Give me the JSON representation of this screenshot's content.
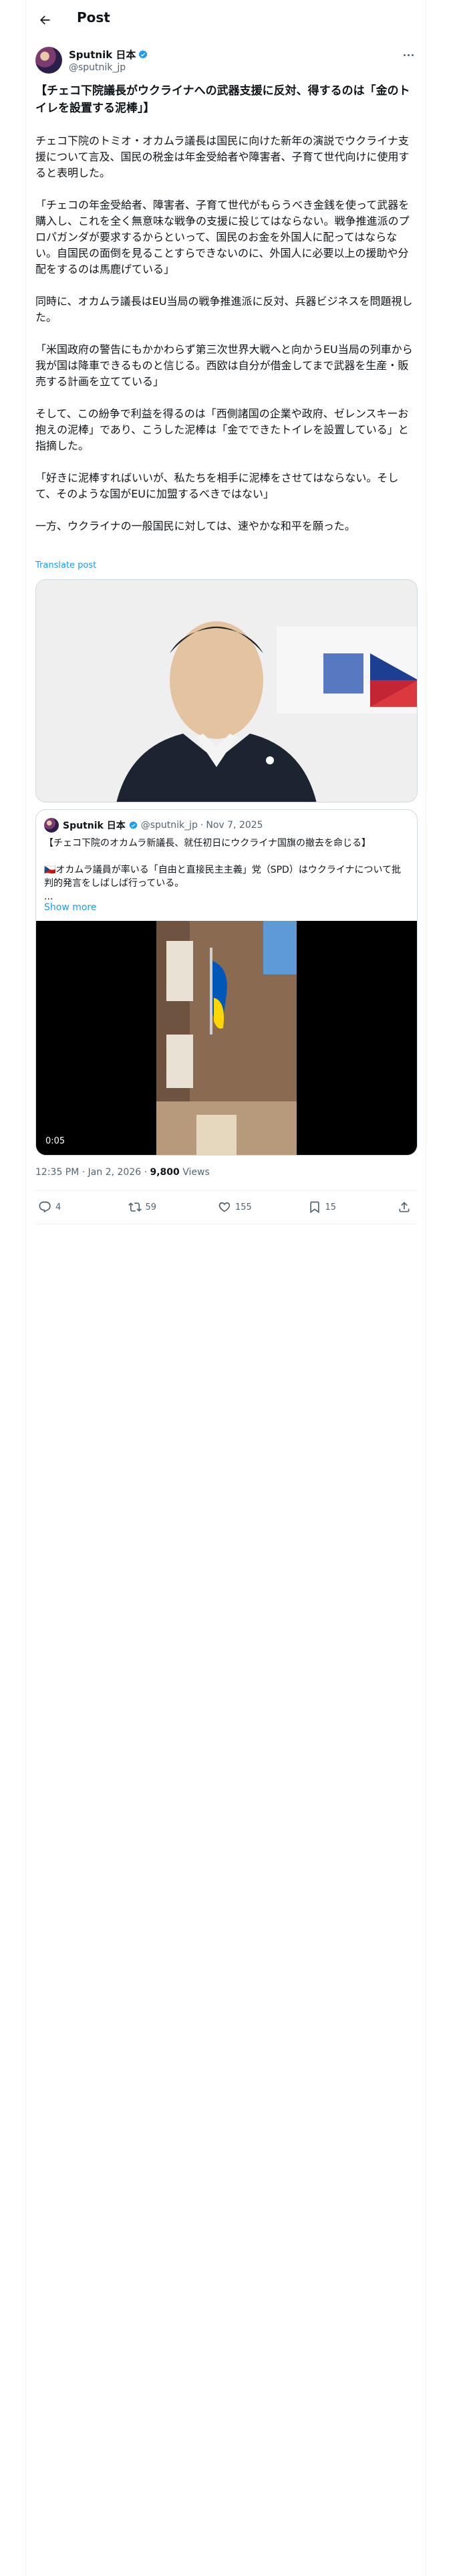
{
  "header": {
    "title": "Post"
  },
  "author": {
    "display_name": "Sputnik 日本",
    "handle": "@sputnik_jp"
  },
  "tweet": {
    "paragraphs": [
      "【チェコ下院議長がウクライナへの武器支援に反対、得するのは「金のトイレを設置する泥棒」】",
      "チェコ下院のトミオ・オカムラ議長は国民に向けた新年の演説でウクライナ支援について言及、国民の税金は年金受給者や障害者、子育て世代向けに使用すると表明した。",
      "「チェコの年金受給者、障害者、子育て世代がもらうべき金銭を使って武器を購入し、これを全く無意味な戦争の支援に投じてはならない。戦争推進派のプロパガンダが要求するからといって、国民のお金を外国人に配ってはならない。自国民の面倒を見ることすらできないのに、外国人に必要以上の援助や分配をするのは馬鹿げている」",
      "同時に、オカムラ議長はEU当局の戦争推進派に反対、兵器ビジネスを問題視した。",
      "「米国政府の警告にもかかわらず第三次世界大戦へと向かうEU当局の列車から我が国は降車できるものと信じる。西欧は自分が借金してまで武器を生産・販売する計画を立てている」",
      "そして、この紛争で利益を得るのは「西側諸国の企業や政府、ゼレンスキーお抱えの泥棒」であり、こうした泥棒は「金でできたトイレを設置している」と指摘した。",
      "「好きに泥棒すればいいが、私たちを相手に泥棒をさせてはならない。そして、そのような国がEUに加盟するべきではない」",
      "一方、ウクライナの一般国民に対しては、速やかな和平を願った。"
    ],
    "translate_label": "Translate post"
  },
  "quote": {
    "display_name": "Sputnik 日本",
    "handle": "@sputnik_jp",
    "date": "Nov 7, 2025",
    "line1": "【チェコ下院のオカムラ新議長、就任初日にウクライナ国旗の撤去を命じる】",
    "line2": "🇨🇿オカムラ議員が率いる「自由と直接民主主義」党（SPD）はウクライナについて批判的発言をしばしば行っている。",
    "ellipsis": "...",
    "show_more": "Show more",
    "video_time": "0:05"
  },
  "meta": {
    "time": "12:35 PM · Jan 2, 2026",
    "views_count": "9,800",
    "views_label": "Views"
  },
  "actions": {
    "replies": "4",
    "reposts": "59",
    "likes": "155",
    "bookmarks": "15"
  },
  "colors": {
    "accent": "#1d9bf0",
    "muted": "#536471",
    "text": "#0f1419",
    "border": "#cfd9de"
  },
  "icons": [
    "back-arrow-icon",
    "verified-badge-icon",
    "more-icon",
    "reply-icon",
    "repost-icon",
    "like-icon",
    "bookmark-icon",
    "share-icon"
  ]
}
